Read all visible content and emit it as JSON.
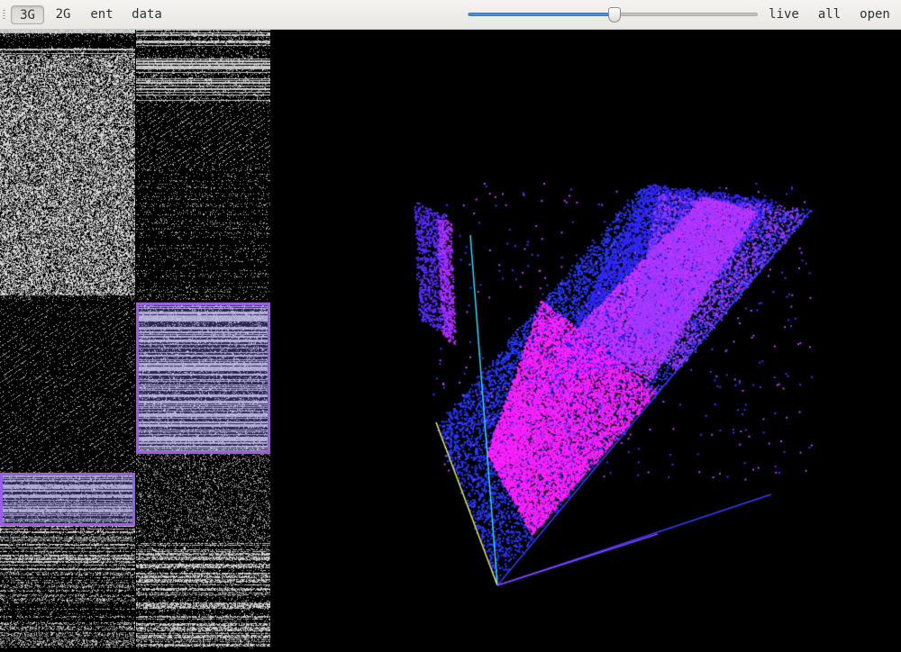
{
  "toolbar": {
    "tabs": [
      {
        "label": "3G",
        "active": true
      },
      {
        "label": "2G",
        "active": false
      },
      {
        "label": "ent",
        "active": false
      },
      {
        "label": "data",
        "active": false
      }
    ],
    "slider": {
      "value": 0.505
    },
    "actions": [
      {
        "label": "live"
      },
      {
        "label": "all"
      },
      {
        "label": "open"
      }
    ]
  },
  "colors": {
    "accent": "#4a90d9",
    "selection": "#9b5de5",
    "scatter_primary": "#ff22ff",
    "scatter_secondary": "#2a3aff",
    "axis_cyan": "#33d6ff",
    "axis_yellow": "#e8e860"
  }
}
